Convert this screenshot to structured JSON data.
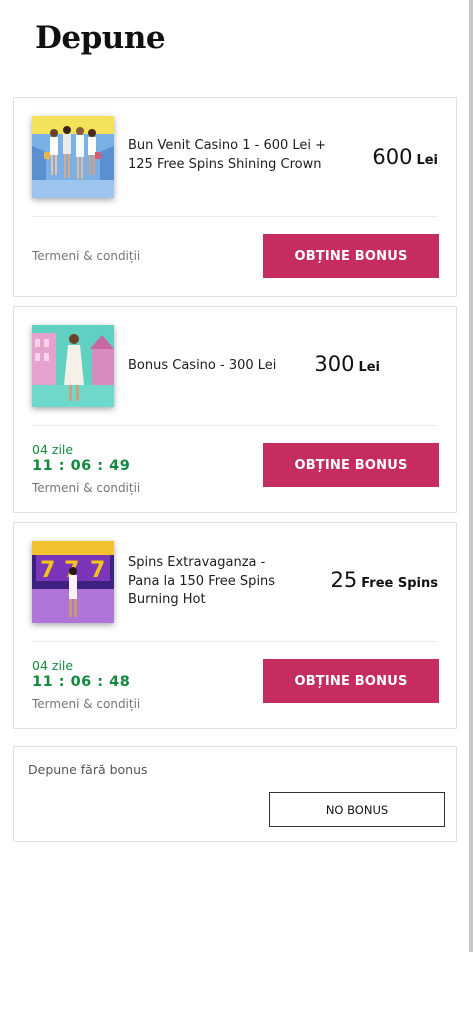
{
  "page": {
    "title": "Depune"
  },
  "offers": [
    {
      "title": "Bun Venit Casino 1 - 600 Lei + 125 Free Spins Shining Crown",
      "amount": "600",
      "unit": "Lei",
      "terms": "Termeni & condiții",
      "button": "OBȚINE BONUS",
      "thumbnail_icon": "welcome-women-image"
    },
    {
      "title": "Bonus Casino - 300 Lei",
      "amount": "300",
      "unit": "Lei",
      "days": "04 zile",
      "timer": "11 : 06 : 49",
      "terms": "Termeni & condiții",
      "button": "OBȚINE BONUS",
      "thumbnail_icon": "casino-woman-image"
    },
    {
      "title": "Spins Extravaganza - Pana la 150 Free Spins Burning Hot",
      "amount": "25",
      "unit": "Free Spins",
      "days": "04 zile",
      "timer": "11 : 06 : 48",
      "terms": "Termeni & condiții",
      "button": "OBȚINE BONUS",
      "thumbnail_icon": "slots-777-image"
    }
  ],
  "no_bonus": {
    "label": "Depune fără bonus",
    "button": "NO BONUS"
  },
  "colors": {
    "accent": "#c52d5e",
    "timer_green": "#128a3e",
    "border": "#e1e1e1"
  }
}
